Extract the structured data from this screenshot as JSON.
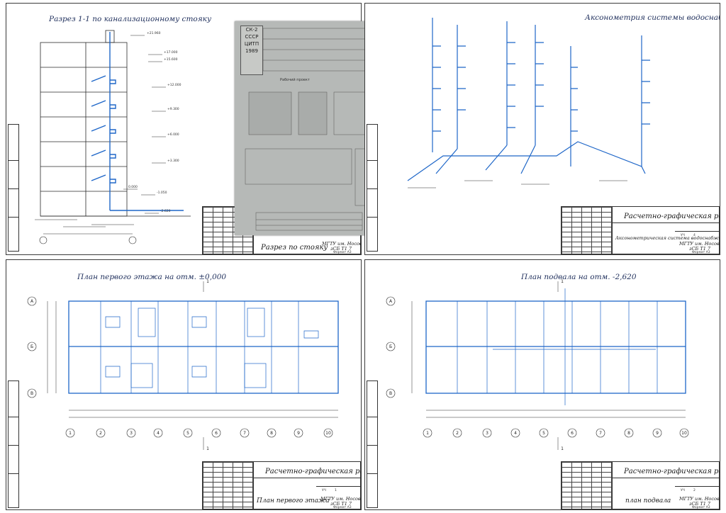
{
  "sheets": {
    "tl": {
      "title": "Разрез 1-1 по канализационному стояку",
      "stamp_main": "Разрез по стояку",
      "stamp_org": "МГТУ им. Носова Г.И.",
      "stamp_group": "зСБ Т1 7",
      "stamp_format": "Формат А3",
      "levels": [
        "+21.960",
        "+17.000",
        "+15.600",
        "+12.000",
        "+9.300",
        "+6.000",
        "+3.300",
        "0.000",
        "-1.050",
        "-2.620"
      ]
    },
    "tr": {
      "title": "Аксонометрия системы водоснабжения",
      "stamp_main": "Расчетно-графическая работа",
      "stamp_sub": "Аксонометрическая система водоснабжения",
      "stamp_org": "МГТУ им. Носова Г.И.",
      "stamp_group": "зСБ Т1 7",
      "stamp_format": "Формат А3",
      "stamp_stage": "УЧ",
      "stamp_sheet": "4"
    },
    "bl": {
      "title": "План первого этажа на отм. ±0,000",
      "stamp_main": "Расчетно-графическая работа",
      "stamp_sub": "План первого этажа",
      "stamp_org": "МГТУ им. Носова Г.И.",
      "stamp_group": "зСБ Т1 7",
      "stamp_format": "Формат А3",
      "stamp_stage": "УЧ",
      "stamp_sheet": "1",
      "section_mark": "1",
      "row_axes": [
        "А",
        "Б",
        "В"
      ],
      "col_axes": [
        "1",
        "2",
        "3",
        "4",
        "5",
        "6",
        "7",
        "8",
        "9",
        "10"
      ]
    },
    "br": {
      "title": "План подвала на отм. -2,620",
      "stamp_main": "Расчетно-графическая работа",
      "stamp_sub": "план подвала",
      "stamp_org": "МГТУ им. Носова Г.И.",
      "stamp_group": "зСБ Т1 7",
      "stamp_format": "Формат А3",
      "stamp_stage": "УЧ",
      "stamp_sheet": "2",
      "section_mark": "1",
      "row_axes": [
        "А",
        "Б",
        "В"
      ],
      "col_axes": [
        "1",
        "2",
        "3",
        "4",
        "5",
        "6",
        "7",
        "8",
        "9",
        "10"
      ]
    }
  },
  "photo": {
    "logo_top": "СК-2",
    "logo_mid": "СССР",
    "logo_sub": "ЦИТП",
    "year": "1989",
    "caption": "Рабочий проект"
  },
  "colors": {
    "blue": "#1e66c8",
    "line": "#2a2a2a",
    "paper": "#ffffff"
  }
}
